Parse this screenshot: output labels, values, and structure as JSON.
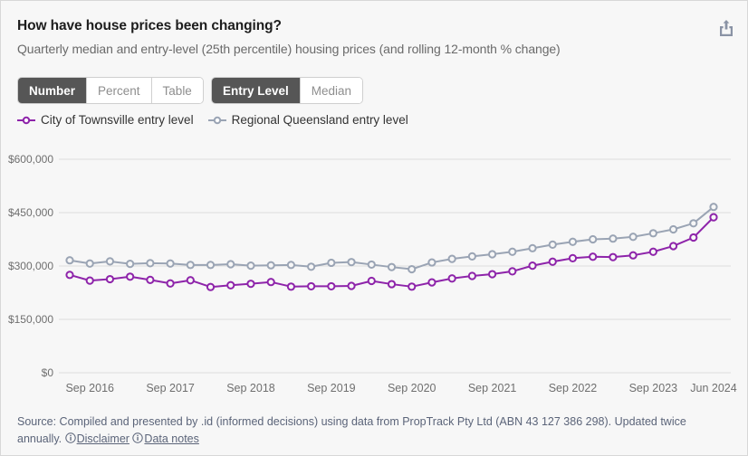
{
  "header": {
    "title": "How have house prices been changing?",
    "subtitle": "Quarterly median and entry-level (25th percentile) housing prices (and rolling 12-month % change)",
    "share_icon": "share-export-icon"
  },
  "controls": {
    "format_group": {
      "name": "format-toggle",
      "options": [
        "Number",
        "Percent",
        "Table"
      ],
      "selected": "Number"
    },
    "measure_group": {
      "name": "measure-toggle",
      "options": [
        "Entry Level",
        "Median"
      ],
      "selected": "Entry Level"
    }
  },
  "footer": {
    "text_part1": "Source: Compiled and presented by .id (informed decisions) using data from PropTrack Pty Ltd (ABN 43 127 386 298). Updated twice annually.",
    "disclaimer_link": "Disclaimer",
    "data_notes_link": "Data notes",
    "info_icon": "info-circle-icon"
  },
  "chart_data": {
    "type": "line",
    "title": "How have house prices been changing?",
    "subtitle": "Quarterly median and entry-level (25th percentile) housing prices (and rolling 12-month % change)",
    "xlabel": "",
    "ylabel": "",
    "ylim": [
      0,
      600000
    ],
    "yticks": [
      0,
      150000,
      300000,
      450000,
      600000
    ],
    "ytick_labels": [
      "$0",
      "$150,000",
      "$300,000",
      "$450,000",
      "$600,000"
    ],
    "grid": true,
    "legend_position": "top-left",
    "x_axis_tick_labels": [
      "Sep 2016",
      "Sep 2017",
      "Sep 2018",
      "Sep 2019",
      "Sep 2020",
      "Sep 2021",
      "Sep 2022",
      "Sep 2023",
      "Jun 2024"
    ],
    "x": [
      "Jun 2016",
      "Sep 2016",
      "Dec 2016",
      "Mar 2017",
      "Jun 2017",
      "Sep 2017",
      "Dec 2017",
      "Mar 2018",
      "Jun 2018",
      "Sep 2018",
      "Dec 2018",
      "Mar 2019",
      "Jun 2019",
      "Sep 2019",
      "Dec 2019",
      "Mar 2020",
      "Jun 2020",
      "Sep 2020",
      "Dec 2020",
      "Mar 2021",
      "Jun 2021",
      "Sep 2021",
      "Dec 2021",
      "Mar 2022",
      "Jun 2022",
      "Sep 2022",
      "Dec 2022",
      "Mar 2023",
      "Jun 2023",
      "Sep 2023",
      "Dec 2023",
      "Mar 2024",
      "Jun 2024"
    ],
    "series": [
      {
        "name": "City of Townsville entry level",
        "color": "#8E24AA",
        "marker": "circle-open",
        "values": [
          275000,
          259000,
          264000,
          270000,
          262000,
          252000,
          260000,
          243000,
          247000,
          250000,
          255000,
          243000,
          244000,
          244000,
          245000,
          258000,
          250000,
          243000,
          255000,
          264000,
          272000,
          277000,
          285000,
          295000,
          312000,
          322000,
          325000,
          325000,
          328000,
          338000,
          352000,
          370000,
          395000,
          437000
        ]
      },
      {
        "name": "Regional Queensland entry level",
        "color": "#9aa4b4",
        "marker": "circle-open",
        "values": [
          316000,
          307000,
          312000,
          306000,
          308000,
          307000,
          303000,
          303000,
          301000,
          301000,
          300000,
          303000,
          298000,
          310000,
          312000,
          306000,
          300000,
          295000,
          310000,
          320000,
          325000,
          331000,
          338000,
          341000,
          355000,
          362000,
          372000,
          378000,
          379000,
          385000,
          395000,
          403000,
          413000,
          426000,
          440000,
          466000
        ]
      }
    ],
    "townsville_points": [
      {
        "x": "Jun 2016",
        "y": 275000
      },
      {
        "x": "Sep 2016",
        "y": 259000
      },
      {
        "x": "Dec 2016",
        "y": 263000
      },
      {
        "x": "Mar 2017",
        "y": 270000
      },
      {
        "x": "Jun 2017",
        "y": 261000
      },
      {
        "x": "Sep 2017",
        "y": 251000
      },
      {
        "x": "Dec 2017",
        "y": 260000
      },
      {
        "x": "Mar 2018",
        "y": 241000
      },
      {
        "x": "Jun 2018",
        "y": 246000
      },
      {
        "x": "Sep 2018",
        "y": 250000
      },
      {
        "x": "Dec 2018",
        "y": 255000
      },
      {
        "x": "Mar 2019",
        "y": 242000
      },
      {
        "x": "Jun 2019",
        "y": 243000
      },
      {
        "x": "Sep 2019",
        "y": 243000
      },
      {
        "x": "Dec 2019",
        "y": 244000
      },
      {
        "x": "Mar 2020",
        "y": 258000
      },
      {
        "x": "Jun 2020",
        "y": 249000
      },
      {
        "x": "Sep 2020",
        "y": 242000
      },
      {
        "x": "Dec 2020",
        "y": 254000
      },
      {
        "x": "Mar 2021",
        "y": 265000
      },
      {
        "x": "Jun 2021",
        "y": 272000
      },
      {
        "x": "Sep 2021",
        "y": 277000
      },
      {
        "x": "Dec 2021",
        "y": 285000
      },
      {
        "x": "Mar 2022",
        "y": 301000
      },
      {
        "x": "Jun 2022",
        "y": 312000
      },
      {
        "x": "Sep 2022",
        "y": 322000
      },
      {
        "x": "Dec 2022",
        "y": 326000
      },
      {
        "x": "Mar 2023",
        "y": 325000
      },
      {
        "x": "Jun 2023",
        "y": 330000
      },
      {
        "x": "Sep 2023",
        "y": 340000
      },
      {
        "x": "Dec 2023",
        "y": 356000
      },
      {
        "x": "Mar 2024",
        "y": 380000
      },
      {
        "x": "Jun 2024",
        "y": 437000
      }
    ],
    "regional_points": [
      {
        "x": "Jun 2016",
        "y": 316000
      },
      {
        "x": "Sep 2016",
        "y": 307000
      },
      {
        "x": "Dec 2016",
        "y": 313000
      },
      {
        "x": "Mar 2017",
        "y": 306000
      },
      {
        "x": "Jun 2017",
        "y": 308000
      },
      {
        "x": "Sep 2017",
        "y": 307000
      },
      {
        "x": "Dec 2017",
        "y": 303000
      },
      {
        "x": "Mar 2018",
        "y": 303000
      },
      {
        "x": "Jun 2018",
        "y": 305000
      },
      {
        "x": "Sep 2018",
        "y": 301000
      },
      {
        "x": "Dec 2018",
        "y": 302000
      },
      {
        "x": "Mar 2019",
        "y": 303000
      },
      {
        "x": "Jun 2019",
        "y": 298000
      },
      {
        "x": "Sep 2019",
        "y": 309000
      },
      {
        "x": "Dec 2019",
        "y": 311000
      },
      {
        "x": "Mar 2020",
        "y": 304000
      },
      {
        "x": "Jun 2020",
        "y": 297000
      },
      {
        "x": "Sep 2020",
        "y": 291000
      },
      {
        "x": "Dec 2020",
        "y": 310000
      },
      {
        "x": "Mar 2021",
        "y": 320000
      },
      {
        "x": "Jun 2021",
        "y": 327000
      },
      {
        "x": "Sep 2021",
        "y": 333000
      },
      {
        "x": "Dec 2021",
        "y": 340000
      },
      {
        "x": "Mar 2022",
        "y": 350000
      },
      {
        "x": "Jun 2022",
        "y": 360000
      },
      {
        "x": "Sep 2022",
        "y": 368000
      },
      {
        "x": "Dec 2022",
        "y": 375000
      },
      {
        "x": "Mar 2023",
        "y": 377000
      },
      {
        "x": "Jun 2023",
        "y": 382000
      },
      {
        "x": "Sep 2023",
        "y": 392000
      },
      {
        "x": "Dec 2023",
        "y": 403000
      },
      {
        "x": "Mar 2024",
        "y": 420000
      },
      {
        "x": "Jun 2024",
        "y": 466000
      }
    ]
  }
}
